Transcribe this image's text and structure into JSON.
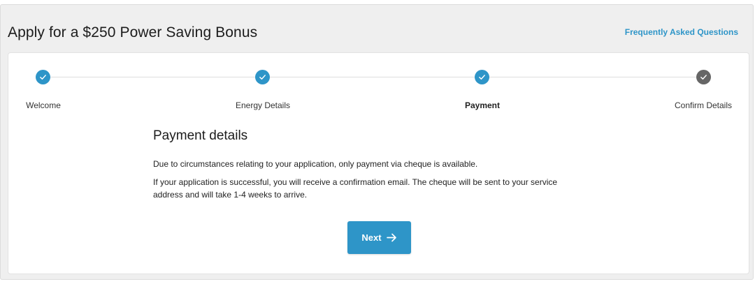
{
  "header": {
    "title": "Apply for a $250 Power Saving Bonus",
    "faq_label": "Frequently Asked Questions"
  },
  "stepper": {
    "steps": [
      {
        "label": "Welcome",
        "status": "complete",
        "icon": "check-icon"
      },
      {
        "label": "Energy Details",
        "status": "complete",
        "icon": "check-icon"
      },
      {
        "label": "Payment",
        "status": "complete",
        "active": true,
        "icon": "check-icon"
      },
      {
        "label": "Confirm Details",
        "status": "pending",
        "icon": "check-icon"
      }
    ]
  },
  "content": {
    "heading": "Payment details",
    "paragraph1": "Due to circumstances relating to your application, only payment via cheque is available.",
    "paragraph2_line1": "If your application is successful, you will receive a confirmation email. The cheque will be sent to your service",
    "paragraph2_line2": "address and will take 1-4 weeks to arrive."
  },
  "actions": {
    "next_label": "Next",
    "next_icon": "arrow-right-icon"
  },
  "colors": {
    "accent": "#2e95c8",
    "pending": "#666666",
    "background": "#efefef"
  }
}
